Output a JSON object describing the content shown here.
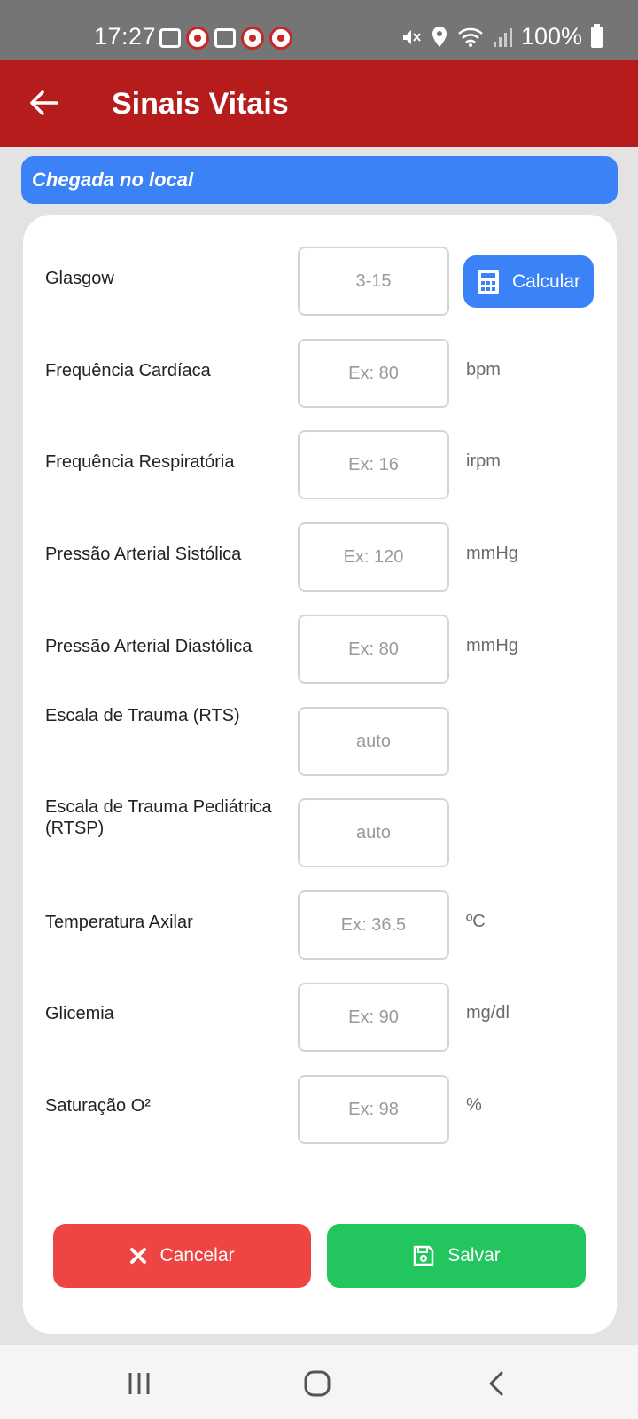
{
  "status_bar": {
    "time": "17:27",
    "battery": "100%"
  },
  "app_bar": {
    "title": "Sinais Vitais",
    "back_icon": "arrow-left-icon"
  },
  "section": {
    "title": "Chegada no local"
  },
  "fields": [
    {
      "label": "Glasgow",
      "placeholder": "3-15",
      "unit": "",
      "value": ""
    },
    {
      "label": "Frequência Cardíaca",
      "placeholder": "Ex: 80",
      "unit": "bpm",
      "value": ""
    },
    {
      "label": "Frequência Respiratória",
      "placeholder": "Ex: 16",
      "unit": "irpm",
      "value": ""
    },
    {
      "label": "Pressão Arterial Sistólica",
      "placeholder": "Ex: 120",
      "unit": "mmHg",
      "value": ""
    },
    {
      "label": "Pressão Arterial Diastólica",
      "placeholder": "Ex: 80",
      "unit": "mmHg",
      "value": ""
    },
    {
      "label": "Escala de Trauma (RTS)",
      "placeholder": "auto",
      "unit": "",
      "value": ""
    },
    {
      "label": "Escala de Trauma Pediátrica (RTSP)",
      "placeholder": "auto",
      "unit": "",
      "value": ""
    },
    {
      "label": "Temperatura Axilar",
      "placeholder": "Ex: 36.5",
      "unit": "ºC",
      "value": ""
    },
    {
      "label": "Glicemia",
      "placeholder": "Ex: 90",
      "unit": "mg/dl",
      "value": ""
    },
    {
      "label": "Saturação O²",
      "placeholder": "Ex: 98",
      "unit": "%",
      "value": ""
    }
  ],
  "calc_button": {
    "label": "Calcular",
    "icon": "calculator-icon"
  },
  "actions": {
    "cancel_label": "Cancelar",
    "cancel_icon": "close-icon",
    "save_label": "Salvar",
    "save_icon": "floppy-disk-icon"
  },
  "colors": {
    "app_bar": "#b71c1c",
    "section": "#3b82f6",
    "calc": "#3b82f6",
    "cancel": "#ef4444",
    "save": "#22c55e"
  }
}
